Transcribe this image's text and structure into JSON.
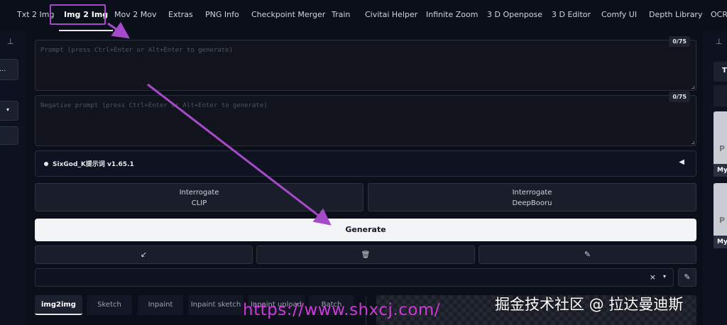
{
  "tabs": [
    {
      "label": "Txt 2 Img",
      "active": false
    },
    {
      "label": "Img 2 Img",
      "active": true
    },
    {
      "label": "Mov 2 Mov",
      "active": false
    },
    {
      "label": "Extras",
      "active": false
    },
    {
      "label": "PNG Info",
      "active": false
    },
    {
      "label": "Checkpoint Merger",
      "active": false
    },
    {
      "label": "Train",
      "active": false
    },
    {
      "label": "Civitai Helper",
      "active": false
    },
    {
      "label": "Infinite Zoom",
      "active": false
    },
    {
      "label": "3 D Openpose",
      "active": false
    },
    {
      "label": "3 D Editor",
      "active": false
    },
    {
      "label": "Comfy UI",
      "active": false
    },
    {
      "label": "Depth Library",
      "active": false
    },
    {
      "label": "OCR",
      "active": false
    }
  ],
  "left_panel": {
    "pin_icon": "pin-icon",
    "item_text": "...",
    "dropdown_icon": "caret-down-icon"
  },
  "prompt": {
    "placeholder": "Prompt (press Ctrl+Enter or Alt+Enter to generate)",
    "token_counter": "0/75",
    "value": ""
  },
  "negative_prompt": {
    "placeholder": "Negative prompt (press Ctrl+Enter or Alt+Enter to generate)",
    "token_counter": "0/75",
    "value": ""
  },
  "extension_accordion": {
    "label": "SixGod_K提示词 v1.65.1",
    "caret_icon": "caret-left-icon"
  },
  "interrogate_buttons": [
    {
      "line1": "Interrogate",
      "line2": "CLIP"
    },
    {
      "line1": "Interrogate",
      "line2": "DeepBooru"
    }
  ],
  "generate_button": {
    "label": "Generate"
  },
  "tool_buttons": [
    {
      "icon": "arrow-down-left-icon",
      "glyph": "↙"
    },
    {
      "icon": "trash-icon",
      "glyph": "🗑"
    },
    {
      "icon": "magic-wand-icon",
      "glyph": "✎"
    }
  ],
  "styles_dropdown": {
    "value": "",
    "clear_glyph": "×",
    "arrow_glyph": "▾",
    "edit_icon": "edit-icon",
    "edit_glyph": "✎"
  },
  "img2img_tabs": [
    {
      "label": "img2img",
      "active": true
    },
    {
      "label": "Sketch",
      "active": false
    },
    {
      "label": "Inpaint",
      "active": false
    },
    {
      "label": "Inpaint sketch",
      "active": false
    },
    {
      "label": "Inpaint upload",
      "active": false
    },
    {
      "label": "Batch",
      "active": false
    }
  ],
  "right_panel": {
    "cards": [
      {
        "caption": "My",
        "letter": "P"
      },
      {
        "caption": "My",
        "letter": "P"
      }
    ],
    "tab_letter": "T",
    "pin_icon": "pin-icon"
  },
  "overlay": {
    "url_text": "https://www.shxcj.com/",
    "watermark": "掘金技术社区 @ 拉达曼迪斯",
    "annotation_color": "#a64ac9"
  }
}
